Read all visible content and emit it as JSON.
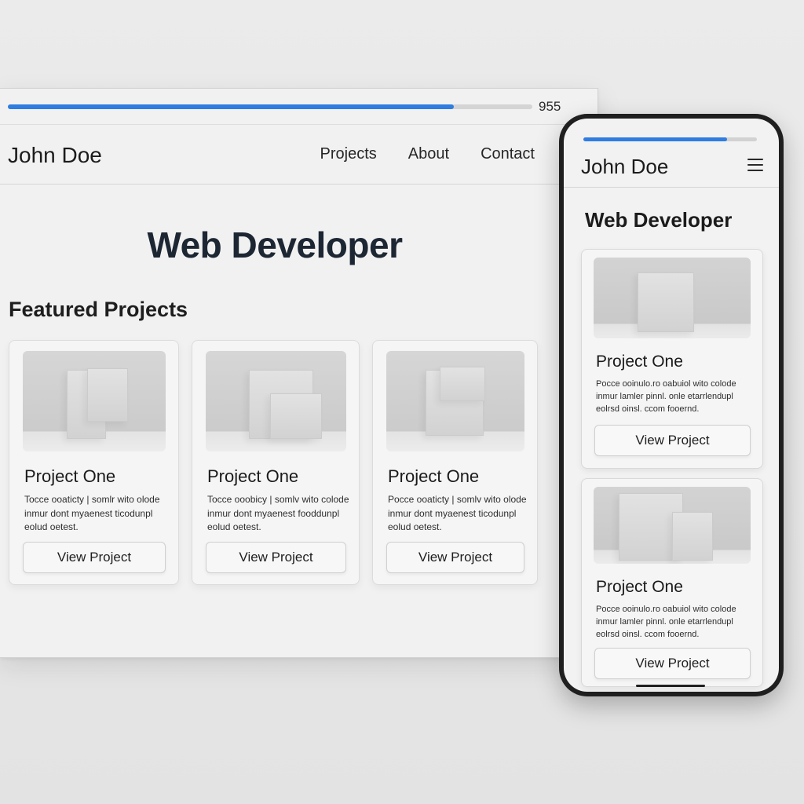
{
  "colors": {
    "accent": "#2f7de1",
    "page_bg": "#e6e6e6",
    "surface": "#f1f1f1",
    "text": "#1c1c1e"
  },
  "desktop": {
    "progress": {
      "fraction": 0.85,
      "value_text": "955"
    },
    "nav": {
      "brand": "John Doe",
      "links": [
        {
          "label": "Projects"
        },
        {
          "label": "About"
        },
        {
          "label": "Contact"
        }
      ]
    },
    "hero_title": "Web Developer",
    "section_title": "Featured Projects",
    "cards": [
      {
        "title": "Project One",
        "description": "Tocce ooaticty | somlr wito olode inmur dont myaenest ticodunpl eolud oetest.",
        "button": "View Project",
        "image_icon": "image-placeholder-icon"
      },
      {
        "title": "Project One",
        "description": "Tocce ooobicy | somlv wito colode inmur dont myaenest fooddunpl eolud oetest.",
        "button": "View Project",
        "image_icon": "image-placeholder-icon"
      },
      {
        "title": "Project One",
        "description": "Pocce ooaticty | somlv wito olode inmur dont myaenest ticodunpl eolud oetest.",
        "button": "View Project",
        "image_icon": "image-placeholder-icon"
      }
    ]
  },
  "mobile": {
    "progress": {
      "fraction": 0.83
    },
    "nav": {
      "brand": "John Doe",
      "menu_icon": "hamburger-menu-icon"
    },
    "hero_title": "Web Developer",
    "cards": [
      {
        "title": "Project One",
        "description": "Pocce ooinulo.ro oabuiol wito colode inmur lamler pinnl. onle etarrlendupl eolrsd oinsl. ccom fooernd.",
        "button": "View Project",
        "image_icon": "image-placeholder-icon"
      },
      {
        "title": "Project One",
        "description": "Pocce ooinulo.ro oabuiol wito colode inmur lamler pinnl. onle etarrlendupl eolrsd oinsl. ccom fooernd.",
        "button": "View Project",
        "image_icon": "image-placeholder-icon"
      }
    ]
  }
}
